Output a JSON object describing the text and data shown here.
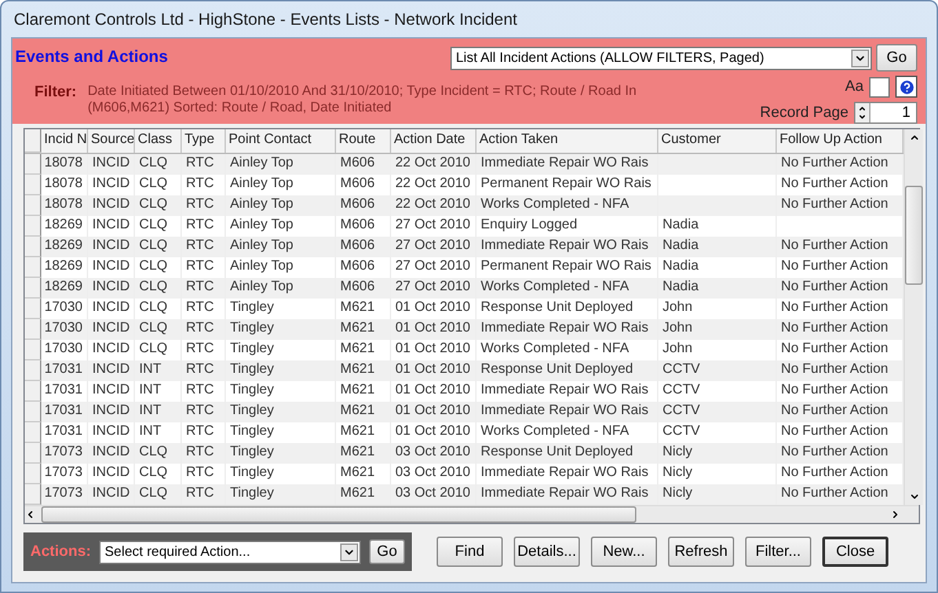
{
  "window": {
    "title": "Claremont Controls Ltd - HighStone - Events Lists - Network Incident"
  },
  "header": {
    "title": "Events and Actions",
    "view_select": {
      "value": "List All Incident Actions (ALLOW FILTERS, Paged)"
    },
    "go_button": "Go",
    "filter_label": "Filter:",
    "filter_text": "Date Initiated Between 01/10/2010 And 31/10/2010; Type Incident = RTC; Route / Road In (M606,M621)   Sorted: Route / Road, Date Initiated",
    "aa_label": "Aa",
    "match_case": {
      "checked": false
    },
    "record_page_label": "Record Page",
    "record_page_value": "1"
  },
  "table": {
    "columns": [
      "Incid N",
      "Source",
      "Class",
      "Type",
      "Point Contact",
      "Route",
      "Action Date",
      "Action Taken",
      "Customer",
      "Follow Up Action"
    ],
    "rows": [
      [
        "18078",
        "INCID",
        "CLQ",
        "RTC",
        "Ainley Top",
        "M606",
        "22 Oct 2010",
        "Immediate Repair WO Rais",
        "",
        "No Further Action"
      ],
      [
        "18078",
        "INCID",
        "CLQ",
        "RTC",
        "Ainley Top",
        "M606",
        "22 Oct 2010",
        "Permanent Repair WO Rais",
        "",
        "No Further Action"
      ],
      [
        "18078",
        "INCID",
        "CLQ",
        "RTC",
        "Ainley Top",
        "M606",
        "22 Oct 2010",
        "Works Completed - NFA",
        "",
        "No Further Action"
      ],
      [
        "18269",
        "INCID",
        "CLQ",
        "RTC",
        "Ainley Top",
        "M606",
        "27 Oct 2010",
        "Enquiry Logged",
        "Nadia",
        ""
      ],
      [
        "18269",
        "INCID",
        "CLQ",
        "RTC",
        "Ainley Top",
        "M606",
        "27 Oct 2010",
        "Immediate Repair WO Rais",
        "Nadia",
        "No Further Action"
      ],
      [
        "18269",
        "INCID",
        "CLQ",
        "RTC",
        "Ainley Top",
        "M606",
        "27 Oct 2010",
        "Permanent Repair WO Rais",
        "Nadia",
        "No Further Action"
      ],
      [
        "18269",
        "INCID",
        "CLQ",
        "RTC",
        "Ainley Top",
        "M606",
        "27 Oct 2010",
        "Works Completed - NFA",
        "Nadia",
        "No Further Action"
      ],
      [
        "17030",
        "INCID",
        "CLQ",
        "RTC",
        "Tingley",
        "M621",
        "01 Oct 2010",
        "Response Unit Deployed",
        "John",
        "No Further Action"
      ],
      [
        "17030",
        "INCID",
        "CLQ",
        "RTC",
        "Tingley",
        "M621",
        "01 Oct 2010",
        "Immediate Repair WO Rais",
        "John",
        "No Further Action"
      ],
      [
        "17030",
        "INCID",
        "CLQ",
        "RTC",
        "Tingley",
        "M621",
        "01 Oct 2010",
        "Works Completed - NFA",
        "John",
        "No Further Action"
      ],
      [
        "17031",
        "INCID",
        "INT",
        "RTC",
        "Tingley",
        "M621",
        "01 Oct 2010",
        "Response Unit Deployed",
        "CCTV",
        "No Further Action"
      ],
      [
        "17031",
        "INCID",
        "INT",
        "RTC",
        "Tingley",
        "M621",
        "01 Oct 2010",
        "Immediate Repair WO Rais",
        "CCTV",
        "No Further Action"
      ],
      [
        "17031",
        "INCID",
        "INT",
        "RTC",
        "Tingley",
        "M621",
        "01 Oct 2010",
        "Immediate Repair WO Rais",
        "CCTV",
        "No Further Action"
      ],
      [
        "17031",
        "INCID",
        "INT",
        "RTC",
        "Tingley",
        "M621",
        "01 Oct 2010",
        "Works Completed - NFA",
        "CCTV",
        "No Further Action"
      ],
      [
        "17073",
        "INCID",
        "CLQ",
        "RTC",
        "Tingley",
        "M621",
        "03 Oct 2010",
        "Response Unit Deployed",
        "Nicly",
        "No Further Action"
      ],
      [
        "17073",
        "INCID",
        "CLQ",
        "RTC",
        "Tingley",
        "M621",
        "03 Oct 2010",
        "Immediate Repair WO Rais",
        "Nicly",
        "No Further Action"
      ],
      [
        "17073",
        "INCID",
        "CLQ",
        "RTC",
        "Tingley",
        "M621",
        "03 Oct 2010",
        "Immediate Repair WO Rais",
        "Nicly",
        "No Further Action"
      ]
    ]
  },
  "footer": {
    "actions_label": "Actions:",
    "action_select": {
      "value": "Select required Action..."
    },
    "go_button": "Go",
    "buttons": [
      {
        "label": "Find",
        "default": false
      },
      {
        "label": "Details...",
        "default": false
      },
      {
        "label": "New...",
        "default": false
      },
      {
        "label": "Refresh",
        "default": false
      },
      {
        "label": "Filter...",
        "default": false
      },
      {
        "label": "Close",
        "default": true
      }
    ]
  }
}
